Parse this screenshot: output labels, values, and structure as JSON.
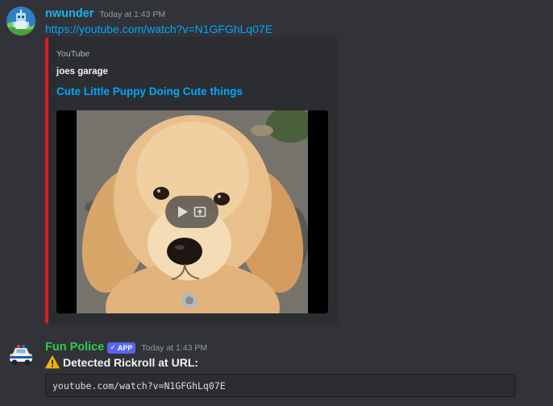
{
  "messages": [
    {
      "username": "nwunder",
      "timestamp": "Today at 1:43 PM",
      "avatar_icon": "robot-avatar-icon",
      "link": "https://youtube.com/watch?v=N1GFGhLq07E",
      "embed": {
        "accent_color": "#e01b1b",
        "provider": "YouTube",
        "author": "joes garage",
        "title": "Cute Little Puppy Doing Cute things",
        "thumbnail": "golden-retriever-puppy-image",
        "play_icon": "play-icon",
        "external_icon": "open-external-icon"
      }
    },
    {
      "username": "Fun Police",
      "badge": "APP",
      "timestamp": "Today at 1:43 PM",
      "avatar_icon": "police-car-icon",
      "warning_icon": "warning-icon",
      "warning_text": "Detected Rickroll at URL:",
      "code": "youtube.com/watch?v=N1GFGhLq07E"
    }
  ],
  "colors": {
    "background": "#313338",
    "embed_background": "#2b2d31",
    "link": "#00a8fc",
    "username_1": "#1ab2f0",
    "username_2": "#2ecc4a",
    "badge": "#5865f2"
  }
}
